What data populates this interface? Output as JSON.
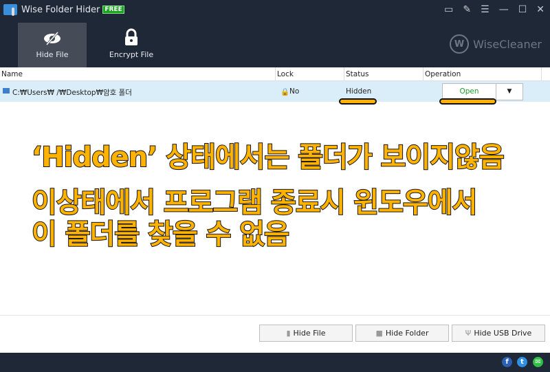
{
  "app": {
    "title": "Wise Folder Hider",
    "badge": "FREE",
    "brand": "WiseCleaner"
  },
  "tabs": [
    {
      "label": "Hide File",
      "active": true
    },
    {
      "label": "Encrypt File",
      "active": false
    }
  ],
  "table": {
    "columns": [
      "Name",
      "Lock",
      "Status",
      "Operation"
    ],
    "rows": [
      {
        "name": "C:₩Users₩      /₩Desktop₩암호 폴더",
        "lock": "No",
        "status": "Hidden",
        "operation": "Open",
        "dropdown": "▼"
      }
    ]
  },
  "annotations": [
    "‘Hidden’ 상태에서는 폴더가 보이지않음",
    "이상태에서 프로그램 종료시 윈도우에서",
    "이 폴더를 찾을 수 없음"
  ],
  "buttons": {
    "hide_file": "Hide File",
    "hide_folder": "Hide Folder",
    "hide_usb": "Hide USB Drive"
  },
  "colors": {
    "header": "#1f2836",
    "row_selected": "#d9eef8",
    "annotation": "#ffb300",
    "open": "#1d9b2a"
  }
}
